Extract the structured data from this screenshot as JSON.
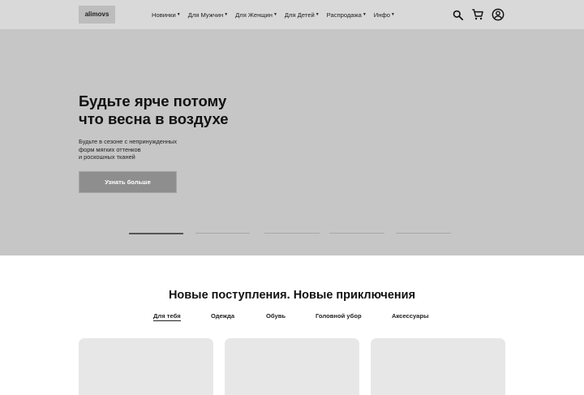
{
  "header": {
    "logo": "alimovs",
    "nav": [
      {
        "label": "Новинки"
      },
      {
        "label": "Для Мужчин"
      },
      {
        "label": "Для Женщин"
      },
      {
        "label": "Для Детей"
      },
      {
        "label": "Распродажа"
      },
      {
        "label": "Инфо"
      }
    ],
    "icons": [
      "search-icon",
      "cart-icon",
      "account-icon"
    ]
  },
  "hero": {
    "title_line1": "Будьте ярче потому",
    "title_line2": "что весна в воздухе",
    "text_line1": "Будьте в сезоне с непринужденных",
    "text_line2": "форм мягких оттенков",
    "text_line3": "и роскошных тканей",
    "button_label": "Узнать больше",
    "slides": {
      "count": 5,
      "active_index": 0
    }
  },
  "new_arrivals": {
    "title": "Новые поступления. Новые приключения",
    "tabs": [
      {
        "label": "Для тебя",
        "active": true
      },
      {
        "label": "Одежда"
      },
      {
        "label": "Обувь"
      },
      {
        "label": "Головной убор"
      },
      {
        "label": "Аксессуары"
      }
    ],
    "card_count": 3
  },
  "colors": {
    "header_bg": "#d9d9d9",
    "hero_bg": "#c6c6c6",
    "button_bg": "#8e8e8e",
    "card_bg": "#e7e7e7"
  }
}
